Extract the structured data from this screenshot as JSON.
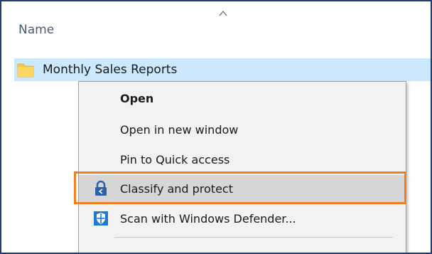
{
  "header": {
    "name_column_label": "Name",
    "sort_icon": "chevron-up-icon"
  },
  "folder": {
    "label": "Monthly Sales Reports",
    "icon": "folder-icon",
    "selected": true
  },
  "context_menu": {
    "items": [
      {
        "label": "Open",
        "bold": true,
        "icon": null
      },
      {
        "label": "Open in new window",
        "icon": null
      },
      {
        "label": "Pin to Quick access",
        "icon": null
      },
      {
        "label": "Classify and protect",
        "icon": "lock-icon",
        "highlighted": true
      },
      {
        "label": "Scan with Windows Defender...",
        "icon": "defender-shield-icon"
      }
    ]
  },
  "colors": {
    "selection_bg": "#cce8ff",
    "highlight_outline": "#f07f1f",
    "frame_border": "#1f3f73",
    "menu_bg": "#f2f2f2"
  }
}
